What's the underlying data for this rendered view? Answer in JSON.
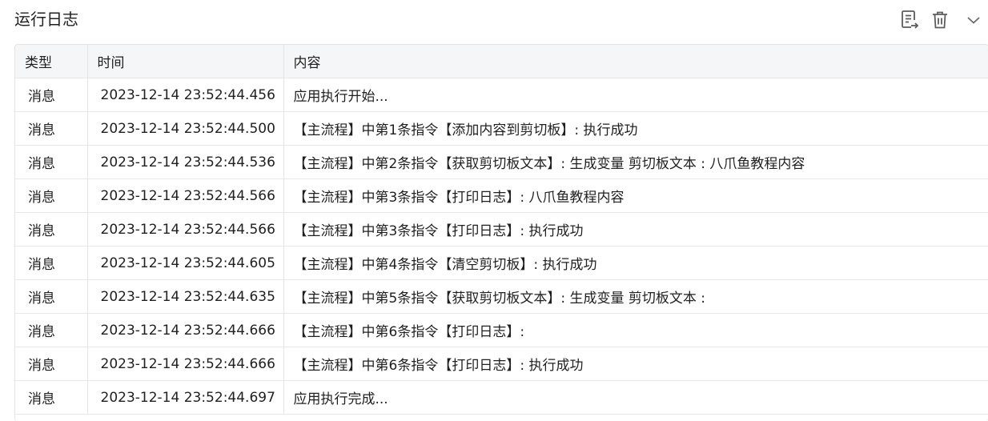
{
  "header": {
    "title": "运行日志",
    "icons": [
      "export-log-icon",
      "trash-icon",
      "chevron-down-icon"
    ]
  },
  "table": {
    "columns": [
      "类型",
      "时间",
      "内容"
    ],
    "rows": [
      {
        "type": "消息",
        "time": "2023-12-14 23:52:44.456",
        "content": "应用执行开始..."
      },
      {
        "type": "消息",
        "time": "2023-12-14 23:52:44.500",
        "content": "【主流程】中第1条指令【添加内容到剪切板】: 执行成功"
      },
      {
        "type": "消息",
        "time": "2023-12-14 23:52:44.536",
        "content": "【主流程】中第2条指令【获取剪切板文本】: 生成变量 剪切板文本 : 八爪鱼教程内容"
      },
      {
        "type": "消息",
        "time": "2023-12-14 23:52:44.566",
        "content": "【主流程】中第3条指令【打印日志】: 八爪鱼教程内容"
      },
      {
        "type": "消息",
        "time": "2023-12-14 23:52:44.566",
        "content": "【主流程】中第3条指令【打印日志】: 执行成功"
      },
      {
        "type": "消息",
        "time": "2023-12-14 23:52:44.605",
        "content": "【主流程】中第4条指令【清空剪切板】: 执行成功"
      },
      {
        "type": "消息",
        "time": "2023-12-14 23:52:44.635",
        "content": "【主流程】中第5条指令【获取剪切板文本】: 生成变量 剪切板文本 :"
      },
      {
        "type": "消息",
        "time": "2023-12-14 23:52:44.666",
        "content": "【主流程】中第6条指令【打印日志】:"
      },
      {
        "type": "消息",
        "time": "2023-12-14 23:52:44.666",
        "content": "【主流程】中第6条指令【打印日志】: 执行成功"
      },
      {
        "type": "消息",
        "time": "2023-12-14 23:52:44.697",
        "content": "应用执行完成..."
      }
    ]
  }
}
